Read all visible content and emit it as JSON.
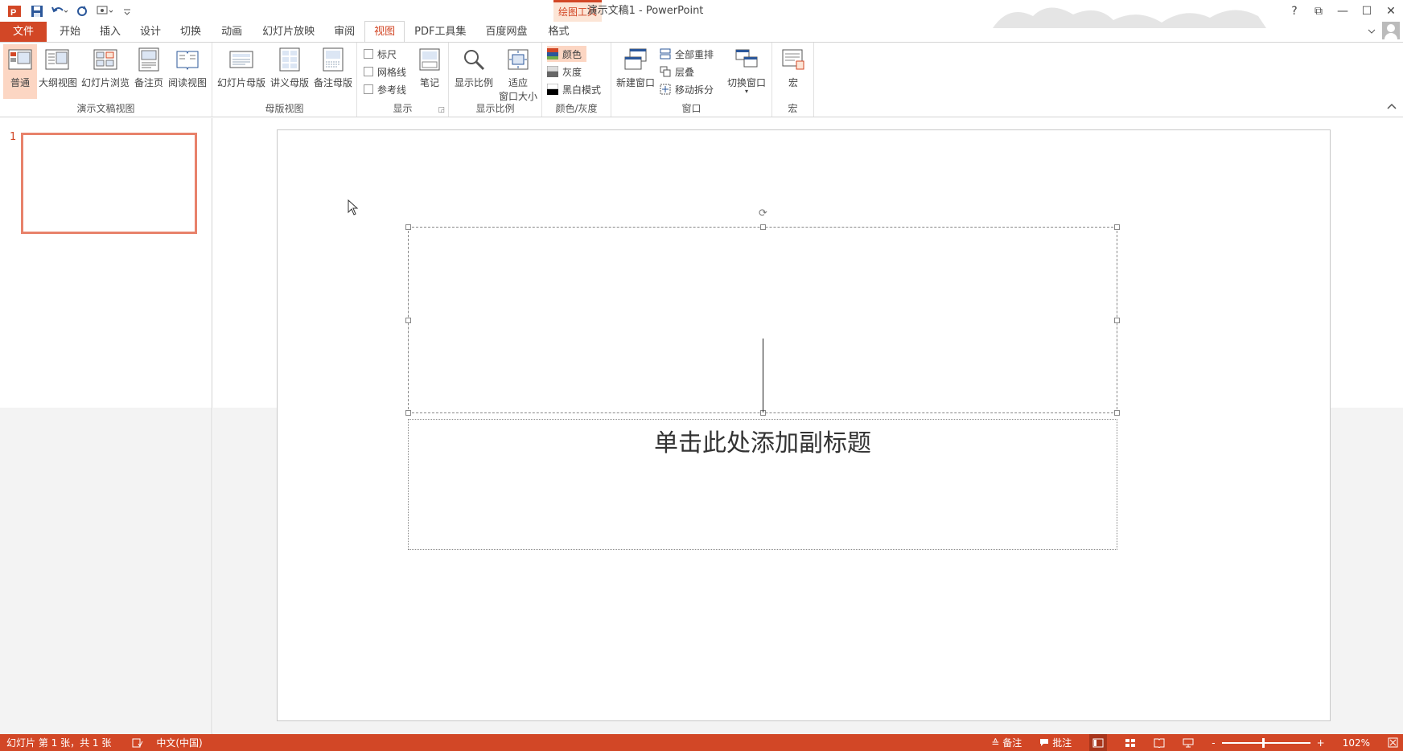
{
  "window": {
    "title": "演示文稿1 - PowerPoint",
    "context_group": "绘图工具",
    "help": "?",
    "restore_ribbon": "⧉",
    "minimize": "—",
    "maximize": "☐",
    "close": "✕"
  },
  "qat": {
    "items": [
      "app-icon",
      "save-icon",
      "undo-icon",
      "redo-icon",
      "presentation-icon",
      "customize-icon"
    ]
  },
  "tabs": [
    {
      "label": "文件"
    },
    {
      "label": "开始"
    },
    {
      "label": "插入"
    },
    {
      "label": "设计"
    },
    {
      "label": "切换"
    },
    {
      "label": "动画"
    },
    {
      "label": "幻灯片放映"
    },
    {
      "label": "审阅"
    },
    {
      "label": "视图",
      "active": true
    },
    {
      "label": "PDF工具集"
    },
    {
      "label": "百度网盘"
    },
    {
      "label": "格式"
    }
  ],
  "ribbon": {
    "presentation_views": {
      "label": "演示文稿视图",
      "buttons": [
        "普通",
        "大纲视图",
        "幻灯片浏览",
        "备注页",
        "阅读视图"
      ]
    },
    "master_views": {
      "label": "母版视图",
      "buttons": [
        "幻灯片母版",
        "讲义母版",
        "备注母版"
      ]
    },
    "show": {
      "label": "显示",
      "checkboxes": [
        "标尺",
        "网格线",
        "参考线"
      ],
      "notes_button": "笔记"
    },
    "zoom": {
      "label": "显示比例",
      "zoom_button": "显示比例",
      "fit_button_line1": "适应",
      "fit_button_line2": "窗口大小"
    },
    "color": {
      "label": "颜色/灰度",
      "options": [
        "颜色",
        "灰度",
        "黑白模式"
      ]
    },
    "window": {
      "label": "窗口",
      "new_window": "新建窗口",
      "options": [
        "全部重排",
        "层叠",
        "移动拆分"
      ],
      "switch_window": "切换窗口"
    },
    "macros": {
      "label": "宏",
      "button": "宏"
    }
  },
  "slides_pane": {
    "slide_number": "1"
  },
  "slide": {
    "subtitle_placeholder": "单击此处添加副标题"
  },
  "status_bar": {
    "slide_info": "幻灯片 第 1 张，共 1 张",
    "language": "中文(中国)",
    "notes": "备注",
    "comments": "批注",
    "zoom_minus": "-",
    "zoom_plus": "+",
    "zoom_level": "102%"
  },
  "colors": {
    "accent": "#d24726",
    "selected_bg": "#fcd6c3",
    "thumb_border": "#e8826b"
  }
}
